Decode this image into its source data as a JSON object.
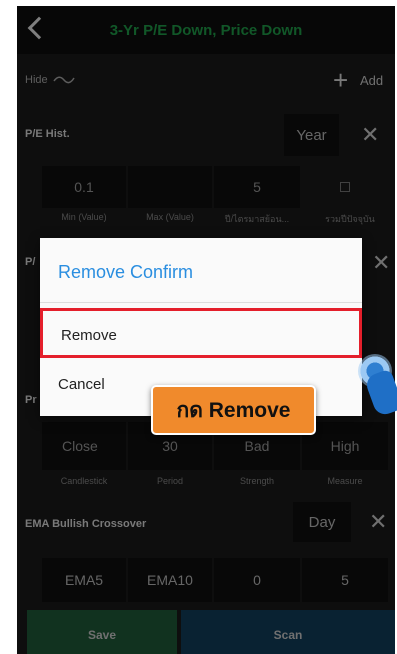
{
  "header": {
    "title": "3-Yr P/E Down, Price Down"
  },
  "toolbar": {
    "hide_label": "Hide",
    "add_label": "Add"
  },
  "pe_hist": {
    "title": "P/E Hist.",
    "period": "Year",
    "values": [
      "0.1",
      "",
      "5"
    ],
    "labels": [
      "Min (Value)",
      "Max (Value)",
      "ปี/ไตรมาสย้อน...",
      "รวมปีปัจจุบัน"
    ]
  },
  "section2": {
    "title_partial": "P/"
  },
  "section3": {
    "title_partial": "Pr",
    "values": [
      "Close",
      "30",
      "Bad",
      "High"
    ],
    "labels": [
      "Candlestick",
      "Period",
      "Strength",
      "Measure"
    ]
  },
  "ema": {
    "title": "EMA Bullish Crossover",
    "period": "Day",
    "values": [
      "EMA5",
      "EMA10",
      "0",
      "5"
    ]
  },
  "dialog": {
    "title": "Remove Confirm",
    "remove_label": "Remove",
    "cancel_label": "Cancel"
  },
  "callout": {
    "text": "กด Remove"
  },
  "bottom": {
    "save_label": "Save",
    "scan_label": "Scan"
  },
  "colors": {
    "title_green": "#1f9e49",
    "dialog_title": "#2a8ee0",
    "highlight_red": "#e41f2b",
    "callout_orange": "#f08a2c"
  }
}
